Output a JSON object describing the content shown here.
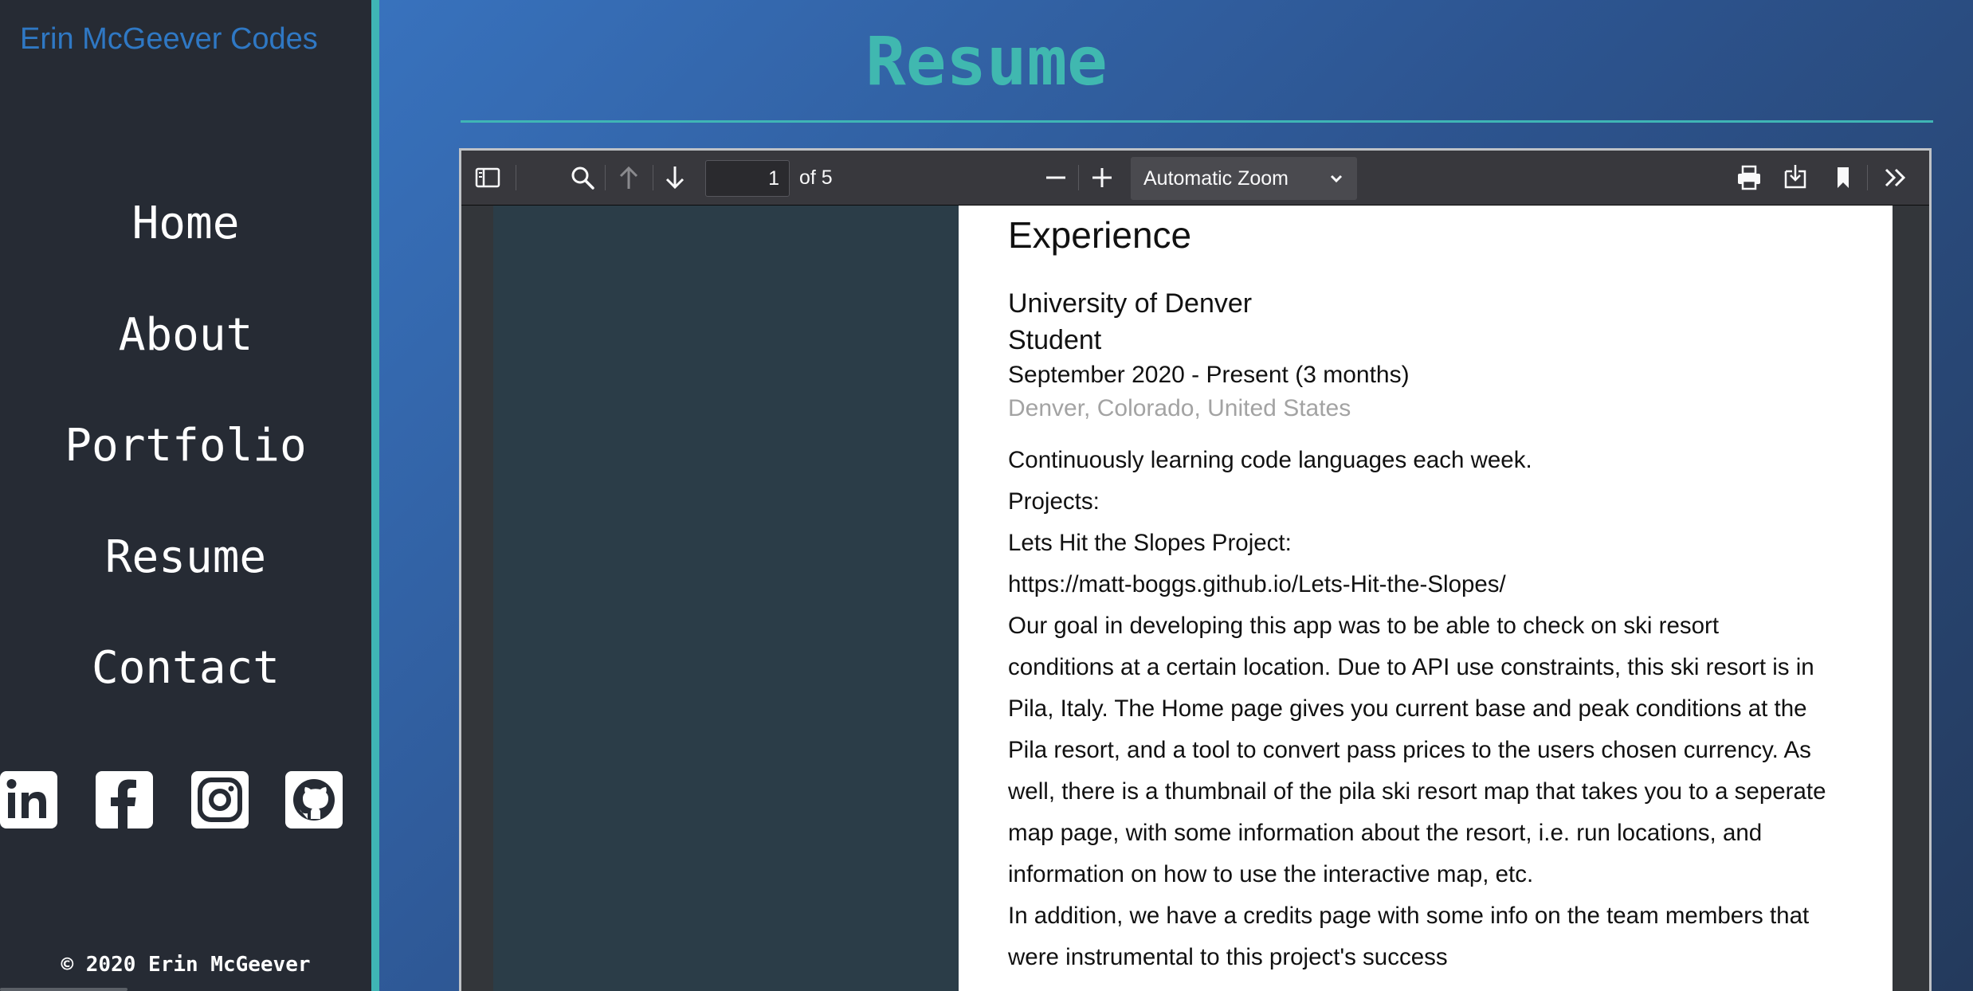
{
  "sidebar": {
    "brand": "Erin McGeever Codes",
    "nav": [
      "Home",
      "About",
      "Portfolio",
      "Resume",
      "Contact"
    ],
    "socials": [
      "linkedin-icon",
      "facebook-icon",
      "instagram-icon",
      "github-icon"
    ],
    "copyright": "© 2020 Erin McGeever"
  },
  "main": {
    "title": "Resume"
  },
  "viewer": {
    "page_current": "1",
    "page_total": "of 5",
    "zoom": "Automatic Zoom"
  },
  "document": {
    "heading": "Experience",
    "org": "University of Denver",
    "role": "Student",
    "dates": "September 2020 - Present (3 months)",
    "location": "Denver, Colorado, United States",
    "lines": [
      "Continuously learning code languages each week.",
      "Projects:",
      "Lets Hit the Slopes Project:",
      "https://matt-boggs.github.io/Lets-Hit-the-Slopes/",
      "Our goal in developing this app was to be able to check on ski resort",
      "conditions at a certain location. Due to API use constraints, this ski resort is in",
      "Pila, Italy. The Home page gives you current base and peak conditions at the",
      "Pila resort, and a tool to convert pass prices to the users chosen currency. As",
      "well, there is a thumbnail of the pila ski resort map that takes you to a seperate",
      "map page, with some information about the resort, i.e. run locations, and",
      "information on how to use the interactive map, etc.",
      "In addition, we have a credits page with some info on the team members that",
      "were instrumental to this project's success"
    ]
  },
  "colors": {
    "sidebar_bg": "#262b34",
    "accent_teal": "#3fb5b5",
    "brand_blue": "#2f78c4",
    "toolbar_bg": "#38383d"
  }
}
